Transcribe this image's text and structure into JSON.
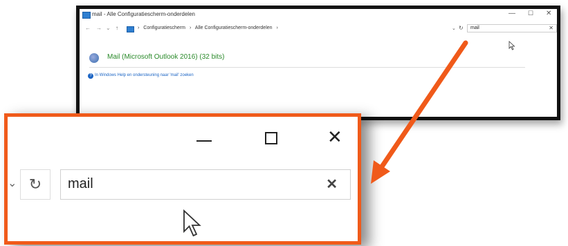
{
  "window": {
    "title": "mail - Alle Configuratiescherm-onderdelen",
    "controls": {
      "minimize": "—",
      "maximize": "☐",
      "close": "✕"
    },
    "nav": {
      "back": "←",
      "forward": "→",
      "recent": "⌄",
      "up": "↑"
    },
    "breadcrumb": [
      "Configuratiescherm",
      "›",
      "Alle Configuratiescherm-onderdelen",
      "›"
    ],
    "breadcrumb_sep_first": "›",
    "dropdown": "⌄",
    "refresh": "↻",
    "search": {
      "value": "mail",
      "clear": "✕"
    },
    "result": "Mail (Microsoft Outlook 2016) (32 bits)",
    "help_link": "In Windows Help en ondersteuning naar 'mail' zoeken"
  },
  "zoom": {
    "controls": {
      "close": "✕"
    },
    "dropdown": "⌄",
    "refresh": "↻",
    "search": {
      "value": "mail",
      "clear": "✕"
    }
  },
  "colors": {
    "callout_border": "#f05a1a",
    "arrow": "#f05a1a",
    "result_link": "#2a8a2a",
    "help_link": "#1a64c4"
  },
  "icons": [
    "control-panel-icon",
    "mail-icon",
    "help-icon",
    "cursor-icon",
    "refresh-icon",
    "close-icon"
  ]
}
